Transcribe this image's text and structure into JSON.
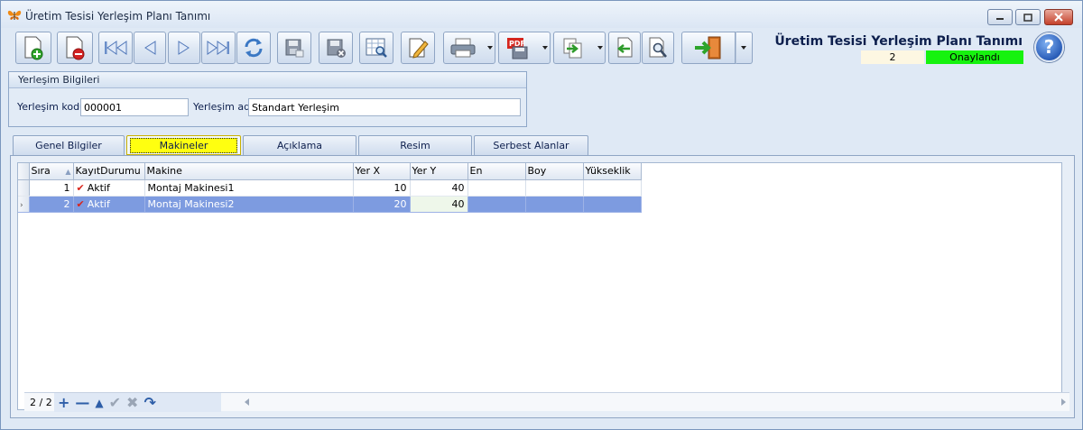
{
  "window": {
    "title": "Üretim Tesisi Yerleşim Planı Tanımı",
    "app_icon": "butterfly-icon"
  },
  "toolbar": {
    "icons": [
      "new-record-icon",
      "delete-record-icon",
      "first-record-icon",
      "previous-record-icon",
      "next-record-icon",
      "last-record-icon",
      "refresh-icon",
      "save-icon",
      "save-cancel-icon",
      "preview-icon",
      "edit-icon",
      "print-icon",
      "pdf-export-icon",
      "export-icon",
      "import-icon",
      "search-icon",
      "exit-icon",
      "help-icon"
    ]
  },
  "header": {
    "form_title": "Üretim Tesisi Yerleşim Planı Tanımı",
    "record_number": "2",
    "status": "Onaylandı",
    "status_color": "#16f20e",
    "help_label": "?"
  },
  "group": {
    "title": "Yerleşim Bilgileri",
    "code_label": "Yerleşim kodu",
    "code_value": "000001",
    "name_label": "Yerleşim adı",
    "name_value": "Standart Yerleşim"
  },
  "tabs": [
    "Genel Bilgiler",
    "Makineler",
    "Açıklama",
    "Resim",
    "Serbest Alanlar"
  ],
  "active_tab": "Makineler",
  "grid": {
    "columns": [
      "Sıra",
      "KayıtDurumu",
      "Makine",
      "Yer X",
      "Yer Y",
      "En",
      "Boy",
      "Yükseklik"
    ],
    "rows": [
      {
        "sira": "1",
        "durum": "Aktif",
        "makine": "Montaj Makinesi1",
        "yer_x": "10",
        "yer_y": "40",
        "en": "",
        "boy": "",
        "yukseklik": ""
      },
      {
        "sira": "2",
        "durum": "Aktif",
        "makine": "Montaj Makinesi2",
        "yer_x": "20",
        "yer_y": "40",
        "en": "",
        "boy": "",
        "yukseklik": ""
      }
    ],
    "selected_row": 2,
    "selected_color": "#7d9be0"
  },
  "navigator": {
    "count": "2 / 2",
    "buttons": [
      {
        "name": "append-icon",
        "glyph": "+"
      },
      {
        "name": "remove-icon",
        "glyph": "—"
      },
      {
        "name": "move-up-icon",
        "glyph": "▲"
      },
      {
        "name": "post-icon",
        "glyph": "✔"
      },
      {
        "name": "cancel-icon",
        "glyph": "✖"
      },
      {
        "name": "refresh-icon",
        "glyph": "↷"
      }
    ]
  }
}
